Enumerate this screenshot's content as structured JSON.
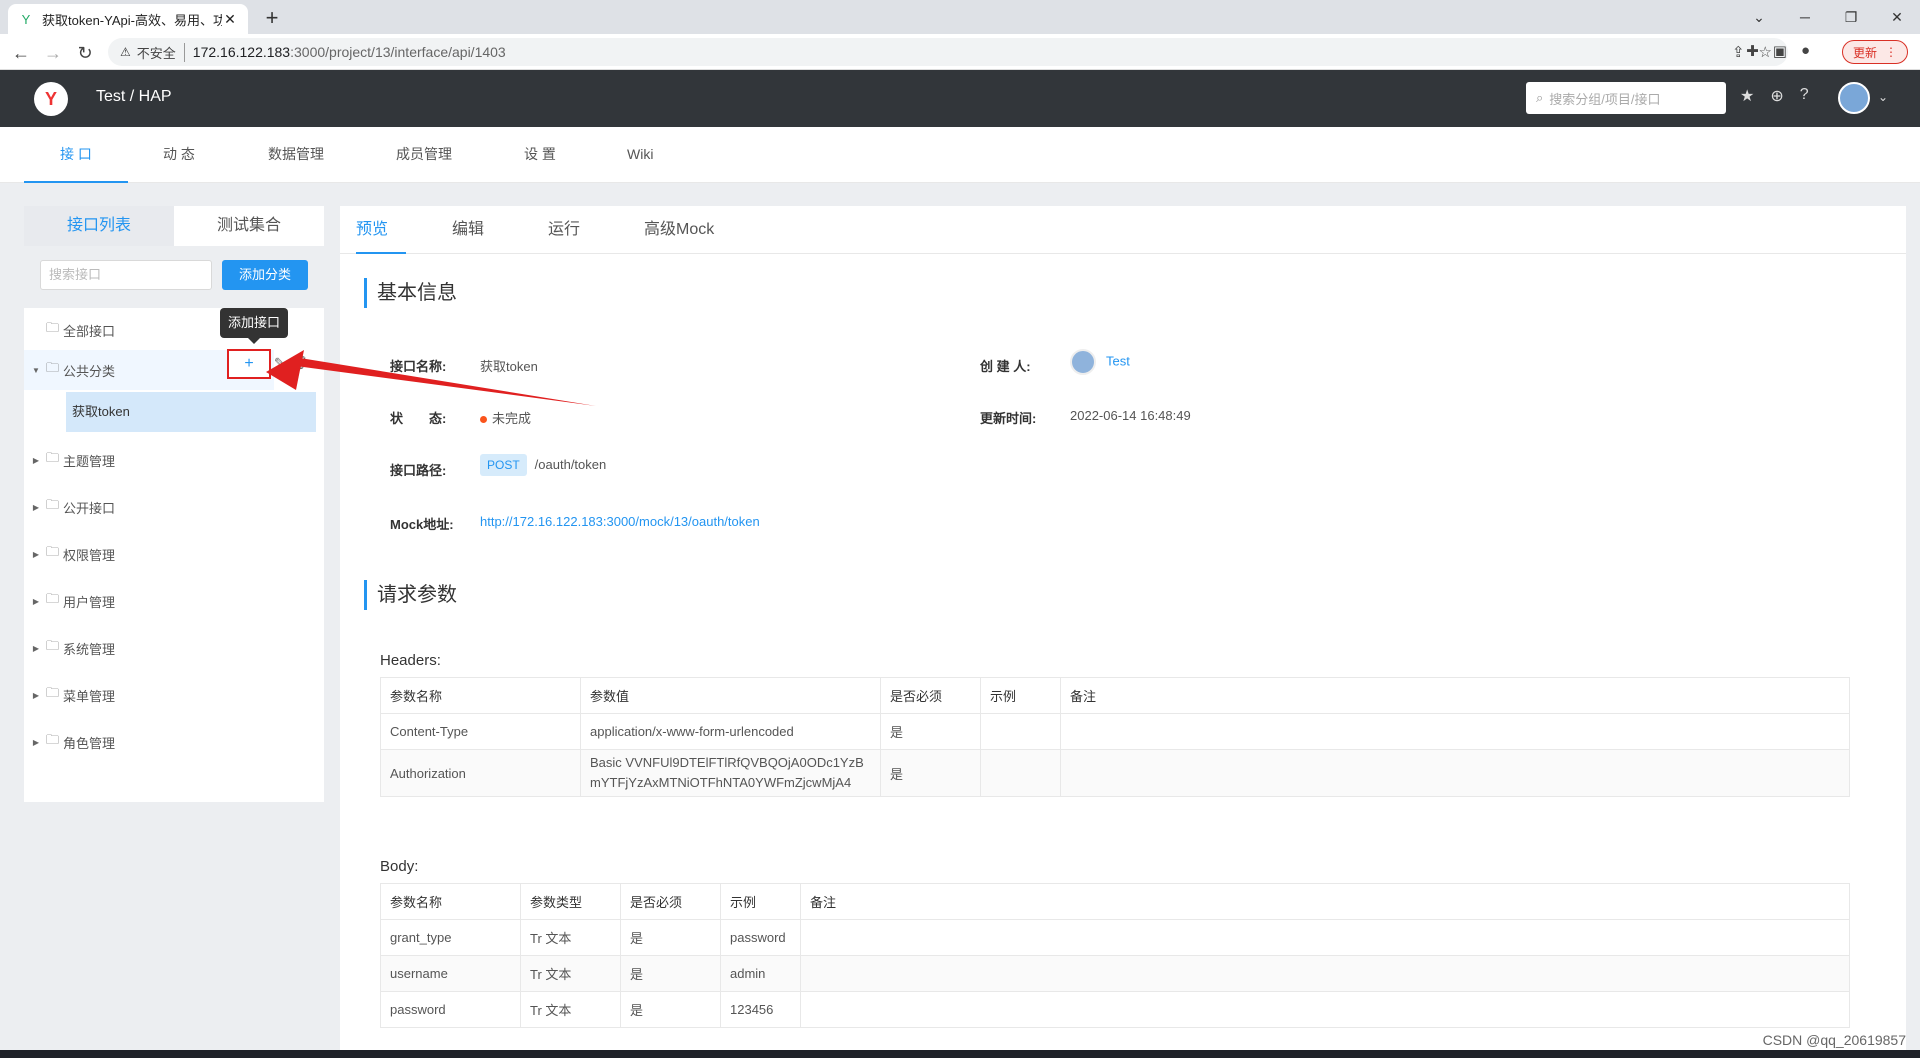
{
  "browser": {
    "tab_title": "获取token-YApi-高效、易用、功",
    "insecure": "不安全",
    "url_host": "172.16.122.183",
    "url_path": ":3000/project/13/interface/api/1403",
    "update_label": "更新"
  },
  "header": {
    "breadcrumb": "Test  /  HAP",
    "search_placeholder": "搜索分组/项目/接口"
  },
  "project_nav": [
    "接 口",
    "动 态",
    "数据管理",
    "成员管理",
    "设 置",
    "Wiki"
  ],
  "left": {
    "tabs": [
      "接口列表",
      "测试集合"
    ],
    "search_placeholder": "搜索接口",
    "add_category": "添加分类",
    "tooltip": "添加接口",
    "plus": "+",
    "tree": [
      {
        "label": "全部接口"
      },
      {
        "label": "公共分类"
      },
      {
        "label": "获取token"
      },
      {
        "label": "主题管理"
      },
      {
        "label": "公开接口"
      },
      {
        "label": "权限管理"
      },
      {
        "label": "用户管理"
      },
      {
        "label": "系统管理"
      },
      {
        "label": "菜单管理"
      },
      {
        "label": "角色管理"
      }
    ]
  },
  "right": {
    "tabs": [
      "预览",
      "编辑",
      "运行",
      "高级Mock"
    ],
    "basic_title": "基本信息",
    "fields": {
      "name_label": "接口名称:",
      "name_value": "获取token",
      "creator_label": "创 建 人:",
      "creator_value": "Test",
      "status_label": "状　　态:",
      "status_value": "未完成",
      "updated_label": "更新时间:",
      "updated_value": "2022-06-14 16:48:49",
      "path_label": "接口路径:",
      "method": "POST",
      "path_value": "/oauth/token",
      "mock_label": "Mock地址:",
      "mock_value": "http://172.16.122.183:3000/mock/13/oauth/token"
    },
    "req_title": "请求参数",
    "headers_label": "Headers:",
    "headers_cols": [
      "参数名称",
      "参数值",
      "是否必须",
      "示例",
      "备注"
    ],
    "headers_rows": [
      [
        "Content-Type",
        "application/x-www-form-urlencoded",
        "是",
        "",
        ""
      ],
      [
        "Authorization",
        "Basic VVNFUl9DTElFTlRfQVBQOjA0ODc1YzBmYTFjYzAxMTNiOTFhNTA0YWFmZjcwMjA4",
        "是",
        "",
        ""
      ]
    ],
    "body_label": "Body:",
    "body_cols": [
      "参数名称",
      "参数类型",
      "是否必须",
      "示例",
      "备注"
    ],
    "body_rows": [
      [
        "grant_type",
        "Tr 文本",
        "是",
        "password",
        ""
      ],
      [
        "username",
        "Tr 文本",
        "是",
        "admin",
        ""
      ],
      [
        "password",
        "Tr 文本",
        "是",
        "123456",
        ""
      ]
    ]
  },
  "watermark": "CSDN @qq_20619857",
  "colors": {
    "accent": "#2395f1",
    "header": "#32363a",
    "annotation": "#e02020"
  }
}
